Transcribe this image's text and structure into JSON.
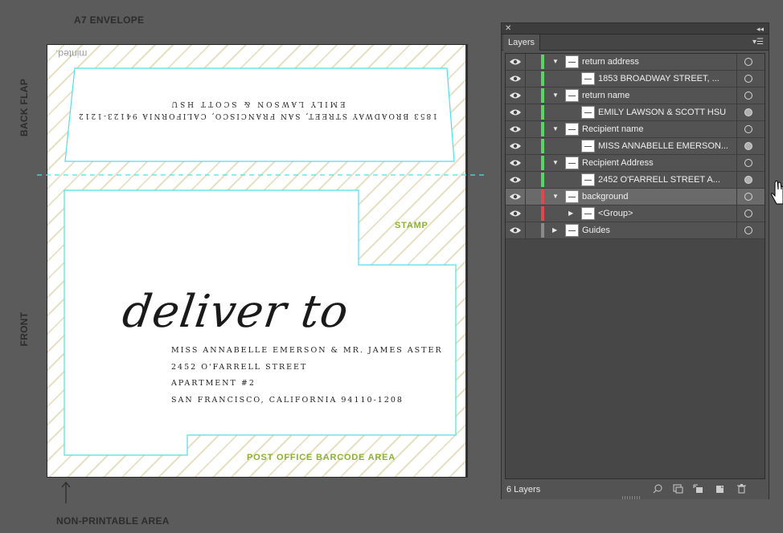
{
  "canvas": {
    "title": "A7 ENVELOPE",
    "back_flap_label": "BACK FLAP",
    "front_label": "FRONT",
    "non_printable_label": "NON-PRINTABLE AREA",
    "stamp_label": "STAMP",
    "barcode_label": "POST OFFICE BARCODE AREA",
    "brand_mark": "minted.",
    "flap_return_address": "1853 BROADWAY STREET, SAN FRANCISCO, CALIFORNIA 94123-1212",
    "flap_return_name": "EMILY LAWSON & SCOTT HSU",
    "deliver_to": "deliver to",
    "recipient_lines": [
      "MISS ANNABELLE EMERSON & MR. JAMES ASTER",
      "2452 O'FARRELL STREET",
      "APARTMENT #2",
      "SAN FRANCISCO, CALIFORNIA 94110-1208"
    ],
    "guide_color": "#4fe0e6",
    "accent_green": "#8bb033"
  },
  "layers_panel": {
    "tab": "Layers",
    "footer_count": "6 Layers",
    "rows": [
      {
        "label": "return address",
        "level": 0,
        "expanded": true,
        "color": "#5fd35f",
        "target_filled": false
      },
      {
        "label": "1853 BROADWAY STREET, ...",
        "level": 1,
        "color": "#5fd35f",
        "target_filled": false
      },
      {
        "label": "return name",
        "level": 0,
        "expanded": true,
        "color": "#5fd35f",
        "target_filled": false
      },
      {
        "label": "EMILY LAWSON & SCOTT HSU",
        "level": 1,
        "color": "#5fd35f",
        "target_filled": true
      },
      {
        "label": "Recipient name",
        "level": 0,
        "expanded": true,
        "color": "#5fd35f",
        "target_filled": false
      },
      {
        "label": "MISS ANNABELLE EMERSON...",
        "level": 1,
        "color": "#5fd35f",
        "target_filled": true
      },
      {
        "label": "Recipient Address",
        "level": 0,
        "expanded": true,
        "color": "#5fd35f",
        "target_filled": false
      },
      {
        "label": "2452 O'FARRELL STREET A...",
        "level": 1,
        "color": "#5fd35f",
        "target_filled": true
      },
      {
        "label": "background",
        "level": 0,
        "expanded": true,
        "color": "#e0484a",
        "target_filled": false,
        "selected": true
      },
      {
        "label": "<Group>",
        "level": 1,
        "expanded": false,
        "color": "#e0484a",
        "target_filled": false
      },
      {
        "label": "Guides",
        "level": 0,
        "expanded": false,
        "color": "#8a8a8a",
        "target_filled": false
      }
    ]
  }
}
